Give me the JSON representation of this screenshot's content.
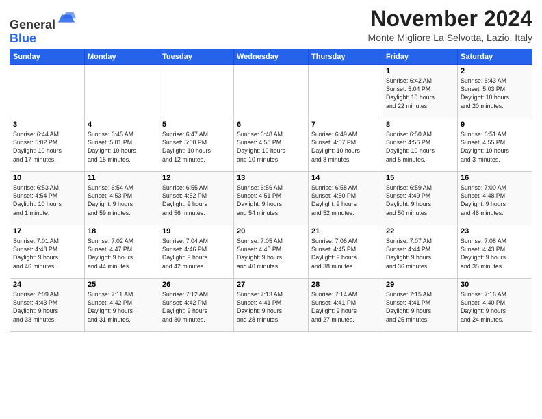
{
  "header": {
    "logo_line1": "General",
    "logo_line2": "Blue",
    "month": "November 2024",
    "location": "Monte Migliore La Selvotta, Lazio, Italy"
  },
  "weekdays": [
    "Sunday",
    "Monday",
    "Tuesday",
    "Wednesday",
    "Thursday",
    "Friday",
    "Saturday"
  ],
  "weeks": [
    [
      {
        "day": "",
        "info": ""
      },
      {
        "day": "",
        "info": ""
      },
      {
        "day": "",
        "info": ""
      },
      {
        "day": "",
        "info": ""
      },
      {
        "day": "",
        "info": ""
      },
      {
        "day": "1",
        "info": "Sunrise: 6:42 AM\nSunset: 5:04 PM\nDaylight: 10 hours\nand 22 minutes."
      },
      {
        "day": "2",
        "info": "Sunrise: 6:43 AM\nSunset: 5:03 PM\nDaylight: 10 hours\nand 20 minutes."
      }
    ],
    [
      {
        "day": "3",
        "info": "Sunrise: 6:44 AM\nSunset: 5:02 PM\nDaylight: 10 hours\nand 17 minutes."
      },
      {
        "day": "4",
        "info": "Sunrise: 6:45 AM\nSunset: 5:01 PM\nDaylight: 10 hours\nand 15 minutes."
      },
      {
        "day": "5",
        "info": "Sunrise: 6:47 AM\nSunset: 5:00 PM\nDaylight: 10 hours\nand 12 minutes."
      },
      {
        "day": "6",
        "info": "Sunrise: 6:48 AM\nSunset: 4:58 PM\nDaylight: 10 hours\nand 10 minutes."
      },
      {
        "day": "7",
        "info": "Sunrise: 6:49 AM\nSunset: 4:57 PM\nDaylight: 10 hours\nand 8 minutes."
      },
      {
        "day": "8",
        "info": "Sunrise: 6:50 AM\nSunset: 4:56 PM\nDaylight: 10 hours\nand 5 minutes."
      },
      {
        "day": "9",
        "info": "Sunrise: 6:51 AM\nSunset: 4:55 PM\nDaylight: 10 hours\nand 3 minutes."
      }
    ],
    [
      {
        "day": "10",
        "info": "Sunrise: 6:53 AM\nSunset: 4:54 PM\nDaylight: 10 hours\nand 1 minute."
      },
      {
        "day": "11",
        "info": "Sunrise: 6:54 AM\nSunset: 4:53 PM\nDaylight: 9 hours\nand 59 minutes."
      },
      {
        "day": "12",
        "info": "Sunrise: 6:55 AM\nSunset: 4:52 PM\nDaylight: 9 hours\nand 56 minutes."
      },
      {
        "day": "13",
        "info": "Sunrise: 6:56 AM\nSunset: 4:51 PM\nDaylight: 9 hours\nand 54 minutes."
      },
      {
        "day": "14",
        "info": "Sunrise: 6:58 AM\nSunset: 4:50 PM\nDaylight: 9 hours\nand 52 minutes."
      },
      {
        "day": "15",
        "info": "Sunrise: 6:59 AM\nSunset: 4:49 PM\nDaylight: 9 hours\nand 50 minutes."
      },
      {
        "day": "16",
        "info": "Sunrise: 7:00 AM\nSunset: 4:48 PM\nDaylight: 9 hours\nand 48 minutes."
      }
    ],
    [
      {
        "day": "17",
        "info": "Sunrise: 7:01 AM\nSunset: 4:48 PM\nDaylight: 9 hours\nand 46 minutes."
      },
      {
        "day": "18",
        "info": "Sunrise: 7:02 AM\nSunset: 4:47 PM\nDaylight: 9 hours\nand 44 minutes."
      },
      {
        "day": "19",
        "info": "Sunrise: 7:04 AM\nSunset: 4:46 PM\nDaylight: 9 hours\nand 42 minutes."
      },
      {
        "day": "20",
        "info": "Sunrise: 7:05 AM\nSunset: 4:45 PM\nDaylight: 9 hours\nand 40 minutes."
      },
      {
        "day": "21",
        "info": "Sunrise: 7:06 AM\nSunset: 4:45 PM\nDaylight: 9 hours\nand 38 minutes."
      },
      {
        "day": "22",
        "info": "Sunrise: 7:07 AM\nSunset: 4:44 PM\nDaylight: 9 hours\nand 36 minutes."
      },
      {
        "day": "23",
        "info": "Sunrise: 7:08 AM\nSunset: 4:43 PM\nDaylight: 9 hours\nand 35 minutes."
      }
    ],
    [
      {
        "day": "24",
        "info": "Sunrise: 7:09 AM\nSunset: 4:43 PM\nDaylight: 9 hours\nand 33 minutes."
      },
      {
        "day": "25",
        "info": "Sunrise: 7:11 AM\nSunset: 4:42 PM\nDaylight: 9 hours\nand 31 minutes."
      },
      {
        "day": "26",
        "info": "Sunrise: 7:12 AM\nSunset: 4:42 PM\nDaylight: 9 hours\nand 30 minutes."
      },
      {
        "day": "27",
        "info": "Sunrise: 7:13 AM\nSunset: 4:41 PM\nDaylight: 9 hours\nand 28 minutes."
      },
      {
        "day": "28",
        "info": "Sunrise: 7:14 AM\nSunset: 4:41 PM\nDaylight: 9 hours\nand 27 minutes."
      },
      {
        "day": "29",
        "info": "Sunrise: 7:15 AM\nSunset: 4:41 PM\nDaylight: 9 hours\nand 25 minutes."
      },
      {
        "day": "30",
        "info": "Sunrise: 7:16 AM\nSunset: 4:40 PM\nDaylight: 9 hours\nand 24 minutes."
      }
    ]
  ]
}
